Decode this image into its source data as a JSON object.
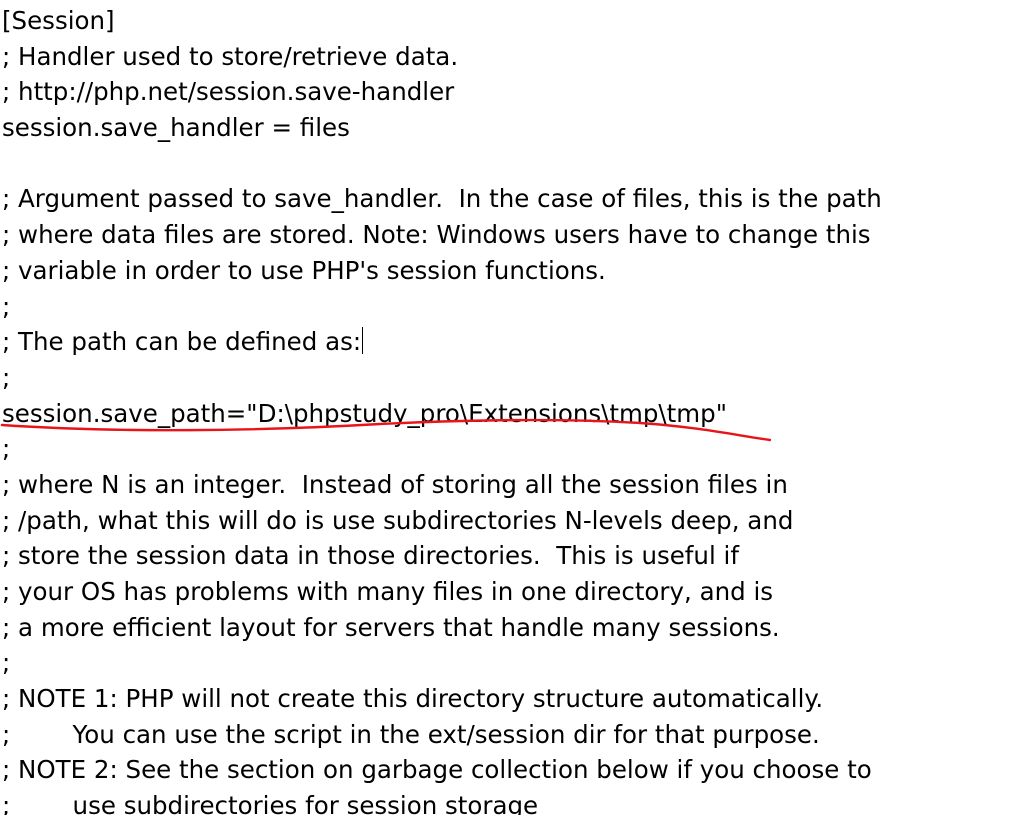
{
  "editor": {
    "caret_line": 9,
    "underline_line": 11,
    "annotation_color": "#e8141a",
    "lines": [
      "[Session]",
      "; Handler used to store/retrieve data.",
      "; http://php.net/session.save-handler",
      "session.save_handler = files",
      "",
      "; Argument passed to save_handler.  In the case of files, this is the path",
      "; where data files are stored. Note: Windows users have to change this",
      "; variable in order to use PHP's session functions.",
      ";",
      "; The path can be defined as:",
      ";",
      "session.save_path=\"D:\\phpstudy_pro\\Extensions\\tmp\\tmp\"",
      ";",
      "; where N is an integer.  Instead of storing all the session files in",
      "; /path, what this will do is use subdirectories N-levels deep, and",
      "; store the session data in those directories.  This is useful if",
      "; your OS has problems with many files in one directory, and is",
      "; a more efficient layout for servers that handle many sessions.",
      ";",
      "; NOTE 1: PHP will not create this directory structure automatically.",
      ";        You can use the script in the ext/session dir for that purpose.",
      "; NOTE 2: See the section on garbage collection below if you choose to",
      ";        use subdirectories for session storage"
    ]
  }
}
